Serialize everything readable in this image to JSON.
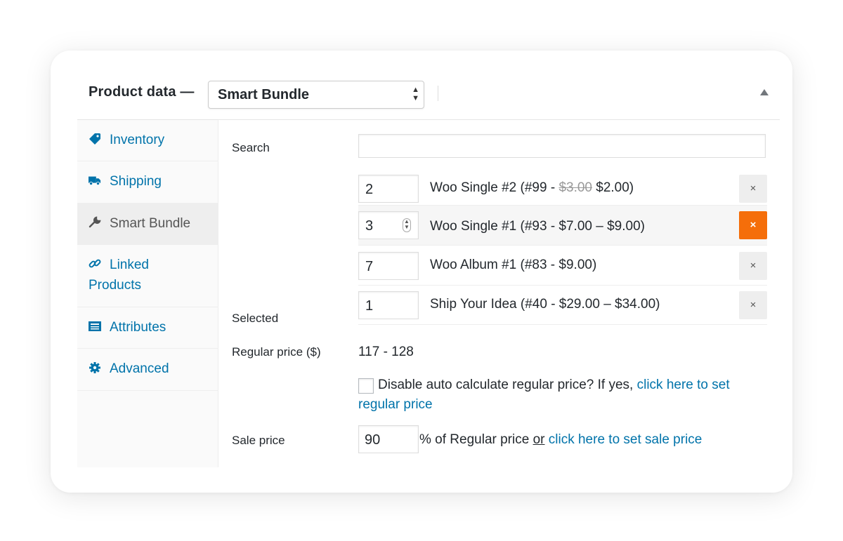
{
  "header": {
    "title": "Product data —",
    "product_type": "Smart Bundle"
  },
  "sidebar": {
    "items": [
      {
        "label": "Inventory",
        "icon": "tag-icon",
        "active": false
      },
      {
        "label": "Shipping",
        "icon": "truck-icon",
        "active": false
      },
      {
        "label": "Smart Bundle",
        "icon": "wrench-icon",
        "active": true
      },
      {
        "label": "Linked",
        "label2": "Products",
        "icon": "link-icon",
        "active": false
      },
      {
        "label": "Attributes",
        "icon": "list-icon",
        "active": false
      },
      {
        "label": "Advanced",
        "icon": "gear-icon",
        "active": false
      }
    ]
  },
  "main": {
    "search_label": "Search",
    "search_value": "",
    "selected_label": "Selected",
    "selected_items": [
      {
        "qty": "2",
        "name": "Woo Single #2 (#99 - ",
        "old_price": "$3.00",
        "price": " $2.00)",
        "remove": "×"
      },
      {
        "qty": "3",
        "name": "Woo Single #1 (#93 - $7.00 – $9.00)",
        "remove": "×"
      },
      {
        "qty": "7",
        "name": "Woo Album #1 (#83 - $9.00)",
        "remove": "×"
      },
      {
        "qty": "1",
        "name": "Ship Your Idea (#40 - $29.00 – $34.00)",
        "remove": "×"
      }
    ],
    "regular_price_label": "Regular price ($)",
    "regular_price_value": "117 - 128",
    "disable_text": "Disable auto calculate regular price? If yes, ",
    "disable_link": "click here to set regular price",
    "sale_price_label": "Sale price",
    "sale_value": "90",
    "sale_text_1": "% of Regular price ",
    "sale_or": "or",
    "sale_link": "click here to set sale price"
  },
  "colors": {
    "link": "#0073aa",
    "remove_active": "#f56e0a"
  }
}
